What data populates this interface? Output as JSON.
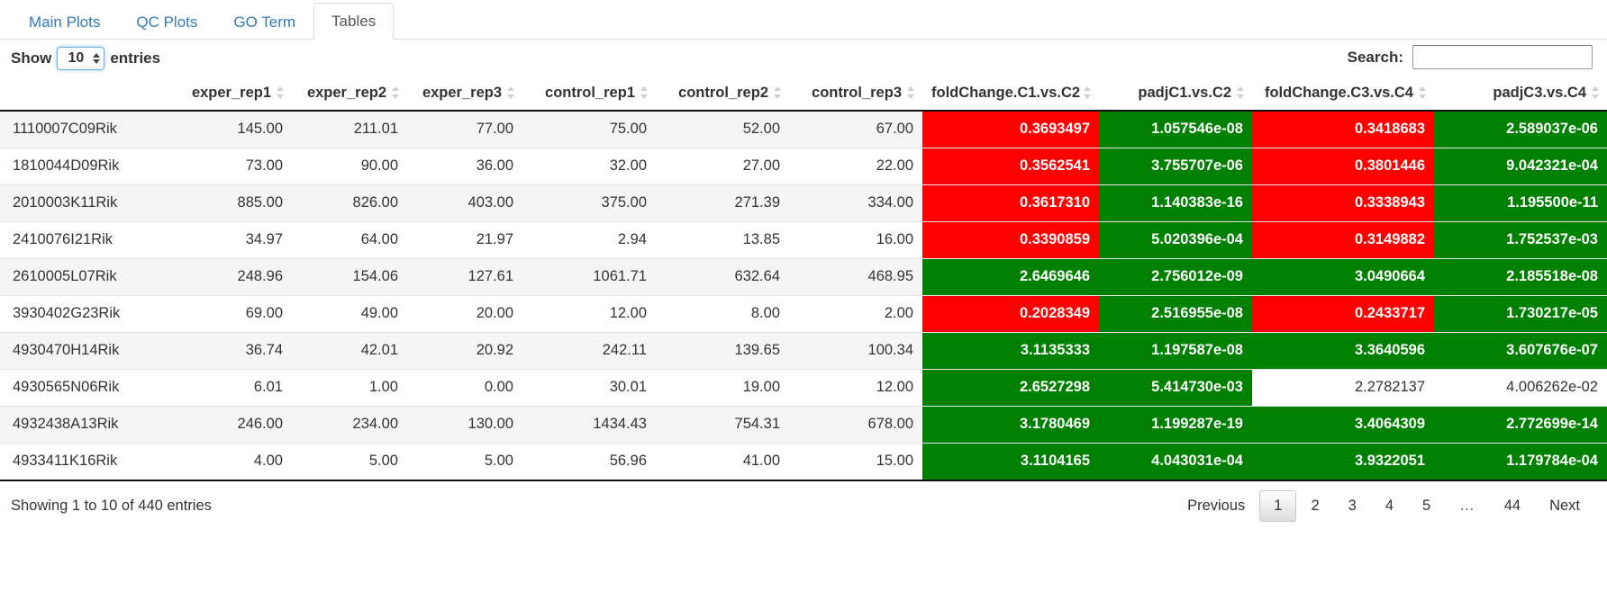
{
  "tabs": [
    {
      "label": "Main Plots",
      "active": false
    },
    {
      "label": "QC Plots",
      "active": false
    },
    {
      "label": "GO Term",
      "active": false
    },
    {
      "label": "Tables",
      "active": true
    }
  ],
  "controls": {
    "show_label": "Show",
    "entries_label": "entries",
    "page_length": "10",
    "search_label": "Search:",
    "search_value": "",
    "search_placeholder": ""
  },
  "table": {
    "columns": [
      {
        "label": "",
        "sortable": false,
        "align": "left"
      },
      {
        "label": "exper_rep1",
        "sortable": true
      },
      {
        "label": "exper_rep2",
        "sortable": true
      },
      {
        "label": "exper_rep3",
        "sortable": true
      },
      {
        "label": "control_rep1",
        "sortable": true
      },
      {
        "label": "control_rep2",
        "sortable": true
      },
      {
        "label": "control_rep3",
        "sortable": true
      },
      {
        "label": "foldChange.C1.vs.C2",
        "sortable": true
      },
      {
        "label": "padjC1.vs.C2",
        "sortable": true
      },
      {
        "label": "foldChange.C3.vs.C4",
        "sortable": true
      },
      {
        "label": "padjC3.vs.C4",
        "sortable": true
      }
    ],
    "rows": [
      {
        "gene": "1110007C09Rik",
        "values": [
          "145.00",
          "211.01",
          "77.00",
          "75.00",
          "52.00",
          "67.00"
        ],
        "stats": [
          {
            "value": "0.3693497",
            "color": "red"
          },
          {
            "value": "1.057546e-08",
            "color": "green"
          },
          {
            "value": "0.3418683",
            "color": "red"
          },
          {
            "value": "2.589037e-06",
            "color": "green"
          }
        ]
      },
      {
        "gene": "1810044D09Rik",
        "values": [
          "73.00",
          "90.00",
          "36.00",
          "32.00",
          "27.00",
          "22.00"
        ],
        "stats": [
          {
            "value": "0.3562541",
            "color": "red"
          },
          {
            "value": "3.755707e-06",
            "color": "green"
          },
          {
            "value": "0.3801446",
            "color": "red"
          },
          {
            "value": "9.042321e-04",
            "color": "green"
          }
        ]
      },
      {
        "gene": "2010003K11Rik",
        "values": [
          "885.00",
          "826.00",
          "403.00",
          "375.00",
          "271.39",
          "334.00"
        ],
        "stats": [
          {
            "value": "0.3617310",
            "color": "red"
          },
          {
            "value": "1.140383e-16",
            "color": "green"
          },
          {
            "value": "0.3338943",
            "color": "red"
          },
          {
            "value": "1.195500e-11",
            "color": "green"
          }
        ]
      },
      {
        "gene": "2410076I21Rik",
        "values": [
          "34.97",
          "64.00",
          "21.97",
          "2.94",
          "13.85",
          "16.00"
        ],
        "stats": [
          {
            "value": "0.3390859",
            "color": "red"
          },
          {
            "value": "5.020396e-04",
            "color": "green"
          },
          {
            "value": "0.3149882",
            "color": "red"
          },
          {
            "value": "1.752537e-03",
            "color": "green"
          }
        ]
      },
      {
        "gene": "2610005L07Rik",
        "values": [
          "248.96",
          "154.06",
          "127.61",
          "1061.71",
          "632.64",
          "468.95"
        ],
        "stats": [
          {
            "value": "2.6469646",
            "color": "green"
          },
          {
            "value": "2.756012e-09",
            "color": "green"
          },
          {
            "value": "3.0490664",
            "color": "green"
          },
          {
            "value": "2.185518e-08",
            "color": "green"
          }
        ]
      },
      {
        "gene": "3930402G23Rik",
        "values": [
          "69.00",
          "49.00",
          "20.00",
          "12.00",
          "8.00",
          "2.00"
        ],
        "stats": [
          {
            "value": "0.2028349",
            "color": "red"
          },
          {
            "value": "2.516955e-08",
            "color": "green"
          },
          {
            "value": "0.2433717",
            "color": "red"
          },
          {
            "value": "1.730217e-05",
            "color": "green"
          }
        ]
      },
      {
        "gene": "4930470H14Rik",
        "values": [
          "36.74",
          "42.01",
          "20.92",
          "242.11",
          "139.65",
          "100.34"
        ],
        "stats": [
          {
            "value": "3.1135333",
            "color": "green"
          },
          {
            "value": "1.197587e-08",
            "color": "green"
          },
          {
            "value": "3.3640596",
            "color": "green"
          },
          {
            "value": "3.607676e-07",
            "color": "green"
          }
        ]
      },
      {
        "gene": "4930565N06Rik",
        "values": [
          "6.01",
          "1.00",
          "0.00",
          "30.01",
          "19.00",
          "12.00"
        ],
        "stats": [
          {
            "value": "2.6527298",
            "color": "green"
          },
          {
            "value": "5.414730e-03",
            "color": "green"
          },
          {
            "value": "2.2782137",
            "color": "none"
          },
          {
            "value": "4.006262e-02",
            "color": "none"
          }
        ]
      },
      {
        "gene": "4932438A13Rik",
        "values": [
          "246.00",
          "234.00",
          "130.00",
          "1434.43",
          "754.31",
          "678.00"
        ],
        "stats": [
          {
            "value": "3.1780469",
            "color": "green"
          },
          {
            "value": "1.199287e-19",
            "color": "green"
          },
          {
            "value": "3.4064309",
            "color": "green"
          },
          {
            "value": "2.772699e-14",
            "color": "green"
          }
        ]
      },
      {
        "gene": "4933411K16Rik",
        "values": [
          "4.00",
          "5.00",
          "5.00",
          "56.96",
          "41.00",
          "15.00"
        ],
        "stats": [
          {
            "value": "3.1104165",
            "color": "green"
          },
          {
            "value": "4.043031e-04",
            "color": "green"
          },
          {
            "value": "3.9322051",
            "color": "green"
          },
          {
            "value": "1.179784e-04",
            "color": "green"
          }
        ]
      }
    ]
  },
  "footer": {
    "info": "Showing 1 to 10 of 440 entries",
    "pages": [
      {
        "label": "Previous",
        "current": false,
        "kind": "prev"
      },
      {
        "label": "1",
        "current": true,
        "kind": "page"
      },
      {
        "label": "2",
        "current": false,
        "kind": "page"
      },
      {
        "label": "3",
        "current": false,
        "kind": "page"
      },
      {
        "label": "4",
        "current": false,
        "kind": "page"
      },
      {
        "label": "5",
        "current": false,
        "kind": "page"
      },
      {
        "label": "…",
        "current": false,
        "kind": "ellipsis"
      },
      {
        "label": "44",
        "current": false,
        "kind": "page"
      },
      {
        "label": "Next",
        "current": false,
        "kind": "next"
      }
    ]
  },
  "colors": {
    "down": "#FF0000",
    "up": "#008000",
    "link": "#337ab7"
  }
}
